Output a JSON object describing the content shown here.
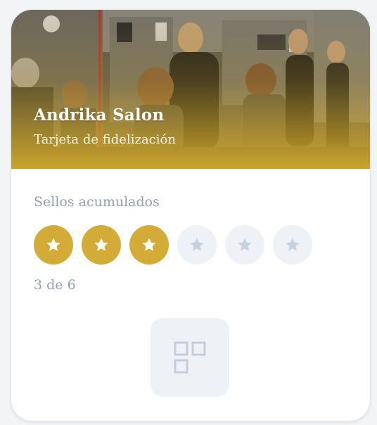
{
  "business": {
    "name": "Andrika Salon",
    "card_type": "Tarjeta de fidelización"
  },
  "stamps": {
    "section_label": "Sellos acumulados",
    "earned": 3,
    "total": 6,
    "progress_text": "3 de 6",
    "filled_color": "#d2ac36",
    "empty_color": "#eef2f7",
    "filled_icon": "star-icon",
    "empty_icon": "star-icon"
  },
  "qr": {
    "icon": "qr-code-icon"
  },
  "colors": {
    "accent": "#d2ac36",
    "muted_text": "#8fa0b8"
  }
}
